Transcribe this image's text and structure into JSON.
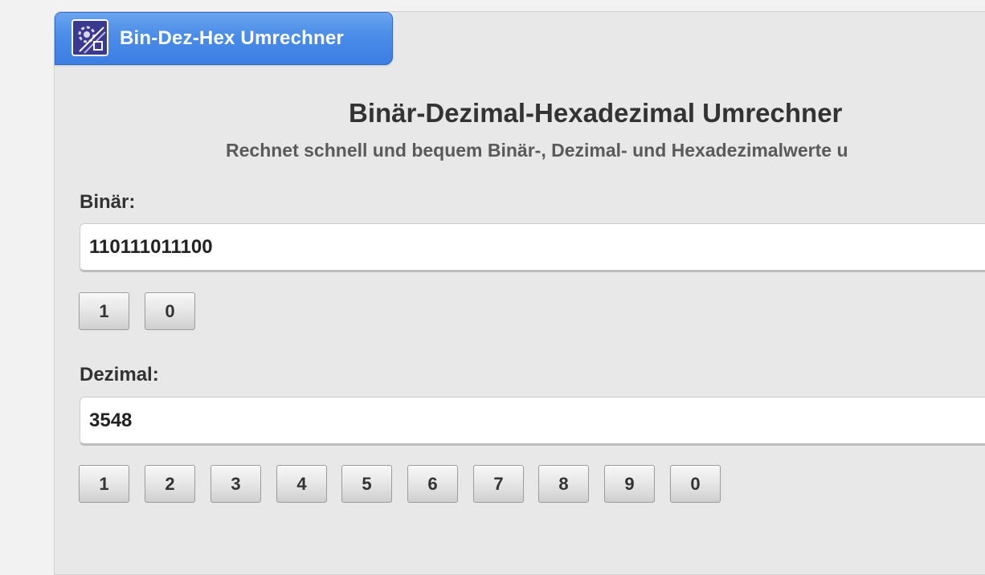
{
  "app": {
    "tab_title": "Bin-Dez-Hex Umrechner",
    "tab_icon": "calculator-app-icon"
  },
  "main": {
    "heading": "Binär-Dezimal-Hexadezimal Umrechner",
    "subheading": "Rechnet schnell und bequem Binär-, Dezimal- und Hexadezimalwerte u"
  },
  "binary": {
    "label": "Binär:",
    "value": "110111011100",
    "keys": [
      "1",
      "0"
    ]
  },
  "decimal": {
    "label": "Dezimal:",
    "value": "3548",
    "keys": [
      "1",
      "2",
      "3",
      "4",
      "5",
      "6",
      "7",
      "8",
      "9",
      "0"
    ]
  },
  "colors": {
    "tab_blue": "#4a8ce8",
    "panel_bg": "#e8e8e8",
    "text_dark": "#333333"
  }
}
